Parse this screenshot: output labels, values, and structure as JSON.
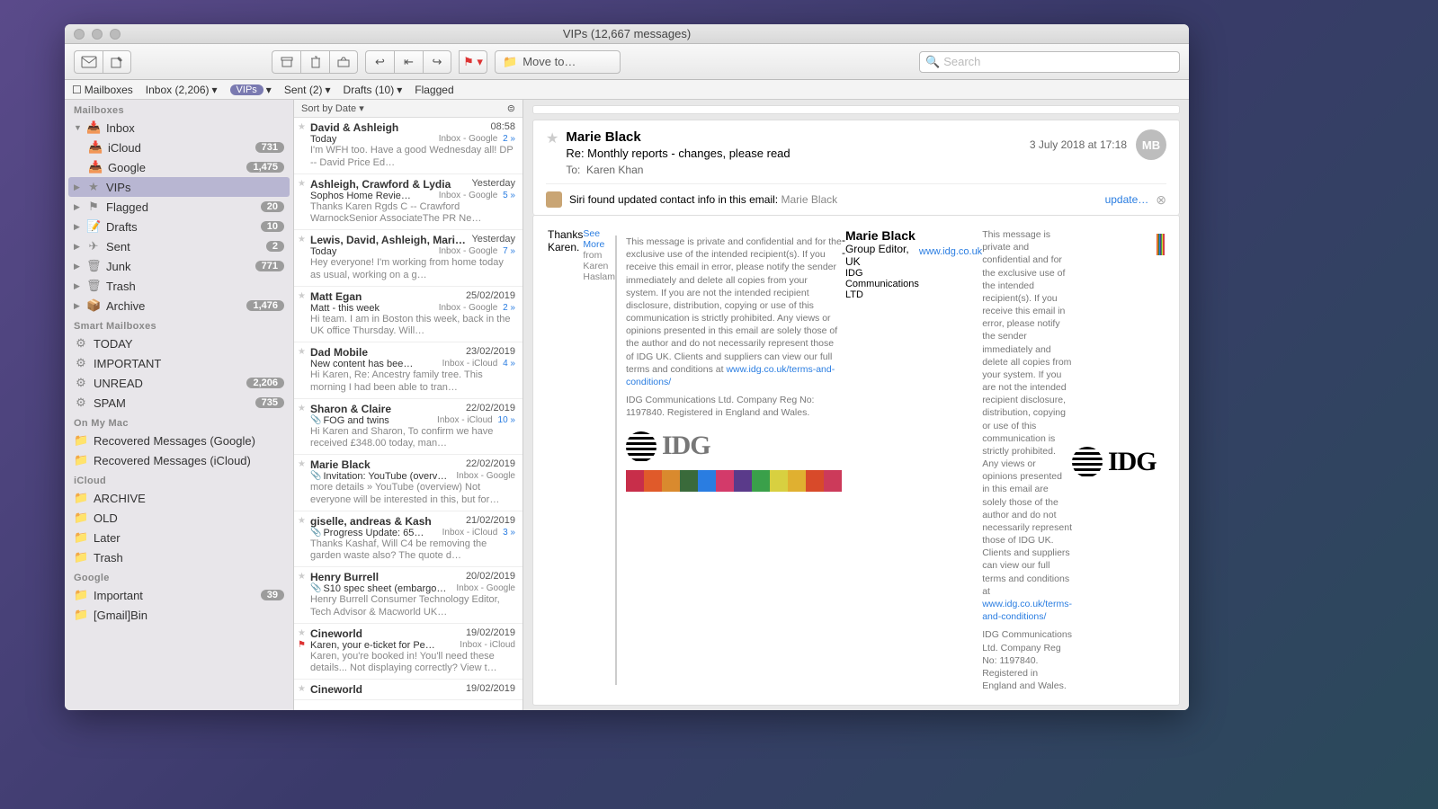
{
  "window": {
    "title": "VIPs (12,667 messages)"
  },
  "toolbar": {
    "move_to": "Move to…",
    "search_placeholder": "Search"
  },
  "favbar": {
    "mailboxes": "Mailboxes",
    "inbox": "Inbox (2,206)",
    "vips": "VIPs",
    "sent": "Sent (2)",
    "drafts": "Drafts (10)",
    "flagged": "Flagged"
  },
  "sidebar": {
    "sections": {
      "mailboxes": "Mailboxes",
      "smart": "Smart Mailboxes",
      "onmymac": "On My Mac",
      "icloud": "iCloud",
      "google": "Google"
    },
    "inbox": "Inbox",
    "icloud_inbox": "iCloud",
    "icloud_badge": "731",
    "google_inbox": "Google",
    "google_badge": "1,475",
    "vips": "VIPs",
    "flagged": "Flagged",
    "flagged_badge": "20",
    "drafts": "Drafts",
    "drafts_badge": "10",
    "sent": "Sent",
    "sent_badge": "2",
    "junk": "Junk",
    "junk_badge": "771",
    "trash": "Trash",
    "archive": "Archive",
    "archive_badge": "1,476",
    "today": "TODAY",
    "important": "IMPORTANT",
    "unread": "UNREAD",
    "unread_badge": "2,206",
    "spam": "SPAM",
    "spam_badge": "735",
    "rec_google": "Recovered Messages (Google)",
    "rec_icloud": "Recovered Messages (iCloud)",
    "i_archive": "ARCHIVE",
    "i_old": "OLD",
    "i_later": "Later",
    "i_trash": "Trash",
    "g_important": "Important",
    "g_important_badge": "39",
    "g_bin": "[Gmail]Bin"
  },
  "sortbar": {
    "label": "Sort by Date"
  },
  "messages": [
    {
      "sender": "David & Ashleigh",
      "date": "08:58",
      "subject": "Today",
      "location": "Inbox - Google",
      "thread": "2",
      "preview": "I'm WFH too. Have a good Wednesday all! DP -- David Price Ed…"
    },
    {
      "sender": "Ashleigh, Crawford & Lydia",
      "date": "Yesterday",
      "subject": "Sophos Home Revie…",
      "location": "Inbox - Google",
      "thread": "5",
      "preview": "Thanks Karen Rgds C -- Crawford WarnockSenior AssociateThe PR Ne…"
    },
    {
      "sender": "Lewis, David, Ashleigh, Mari…",
      "date": "Yesterday",
      "subject": "Today",
      "location": "Inbox - Google",
      "thread": "7",
      "preview": "Hey everyone! I'm working from home today as usual, working on a g…"
    },
    {
      "sender": "Matt Egan",
      "date": "25/02/2019",
      "subject": "Matt - this week",
      "location": "Inbox - Google",
      "thread": "2",
      "preview": "Hi team. I am in Boston this week, back in the UK office Thursday. Will…"
    },
    {
      "sender": "Dad Mobile",
      "date": "23/02/2019",
      "subject": "New content has bee…",
      "location": "Inbox - iCloud",
      "thread": "4",
      "preview": "Hi Karen, Re: Ancestry family tree. This morning I had been able to tran…"
    },
    {
      "sender": "Sharon & Claire",
      "date": "22/02/2019",
      "subject": "FOG and twins",
      "location": "Inbox - iCloud",
      "thread": "10",
      "preview": "Hi Karen and Sharon, To confirm we have received £348.00 today, man…",
      "attach": true
    },
    {
      "sender": "Marie Black",
      "date": "22/02/2019",
      "subject": "Invitation: YouTube (overv…",
      "location": "Inbox - Google",
      "thread": "",
      "preview": "more details » YouTube (overview) Not everyone will be interested in this, but for…",
      "attach": true
    },
    {
      "sender": "giselle, andreas & Kash",
      "date": "21/02/2019",
      "subject": "Progress Update: 65…",
      "location": "Inbox - iCloud",
      "thread": "3",
      "preview": "Thanks Kashaf, Will C4 be removing the garden waste also? The quote d…",
      "attach": true
    },
    {
      "sender": "Henry Burrell",
      "date": "20/02/2019",
      "subject": "S10 spec sheet (embargo…",
      "location": "Inbox - Google",
      "thread": "",
      "preview": "Henry Burrell Consumer Technology Editor, Tech Advisor & Macworld UK…",
      "attach": true
    },
    {
      "sender": "Cineworld",
      "date": "19/02/2019",
      "subject": "Karen, your e-ticket for Pe…",
      "location": "Inbox - iCloud",
      "thread": "",
      "preview": "Karen, you're booked in! You'll need these details... Not displaying correctly? View t…",
      "flag": true
    },
    {
      "sender": "Cineworld",
      "date": "19/02/2019",
      "subject": "",
      "location": "",
      "thread": "",
      "preview": ""
    }
  ],
  "reader": {
    "from": "Marie Black",
    "timestamp": "3 July 2018 at 17:18",
    "avatar": "MB",
    "subject": "Re: Monthly reports - changes, please read",
    "to_label": "To:",
    "to_value": "Karen Khan",
    "siri_text": "Siri found updated contact info in this email:",
    "siri_name": "Marie Black",
    "siri_update": "update…",
    "greeting": "Thanks Karen.",
    "see_more": "See More",
    "see_more_from": "from Karen Haslam",
    "disclaimer1": "This message is private and confidential and for the exclusive use of the intended recipient(s). If you receive this email in error, please notify the sender immediately and delete all copies from your system. If you are not the intended recipient disclosure, distribution, copying or use of this communication is strictly prohibited.  Any  views  or opinions presented in this email are solely those of the author and do not necessarily represent those of IDG UK. Clients and suppliers can view our full terms and conditions at ",
    "tc_link": "www.idg.co.uk/terms-and-conditions/",
    "registered": "IDG Communications Ltd. Company Reg No: 1197840. Registered in England and Wales.",
    "idg": "IDG",
    "sig_dashes": "--",
    "sig_name": "Marie Black",
    "sig_title": "Group Editor, UK",
    "sig_company": "IDG Communications LTD",
    "sig_link": "www.idg.co.uk"
  },
  "colorbar": [
    "#c82e4a",
    "#e05a2a",
    "#d98a2e",
    "#3a6a3a",
    "#2a7de1",
    "#d33a6a",
    "#5a3a8a",
    "#3aa04a",
    "#d8d040",
    "#e0b030",
    "#d84a2a",
    "#cc3a5a"
  ]
}
